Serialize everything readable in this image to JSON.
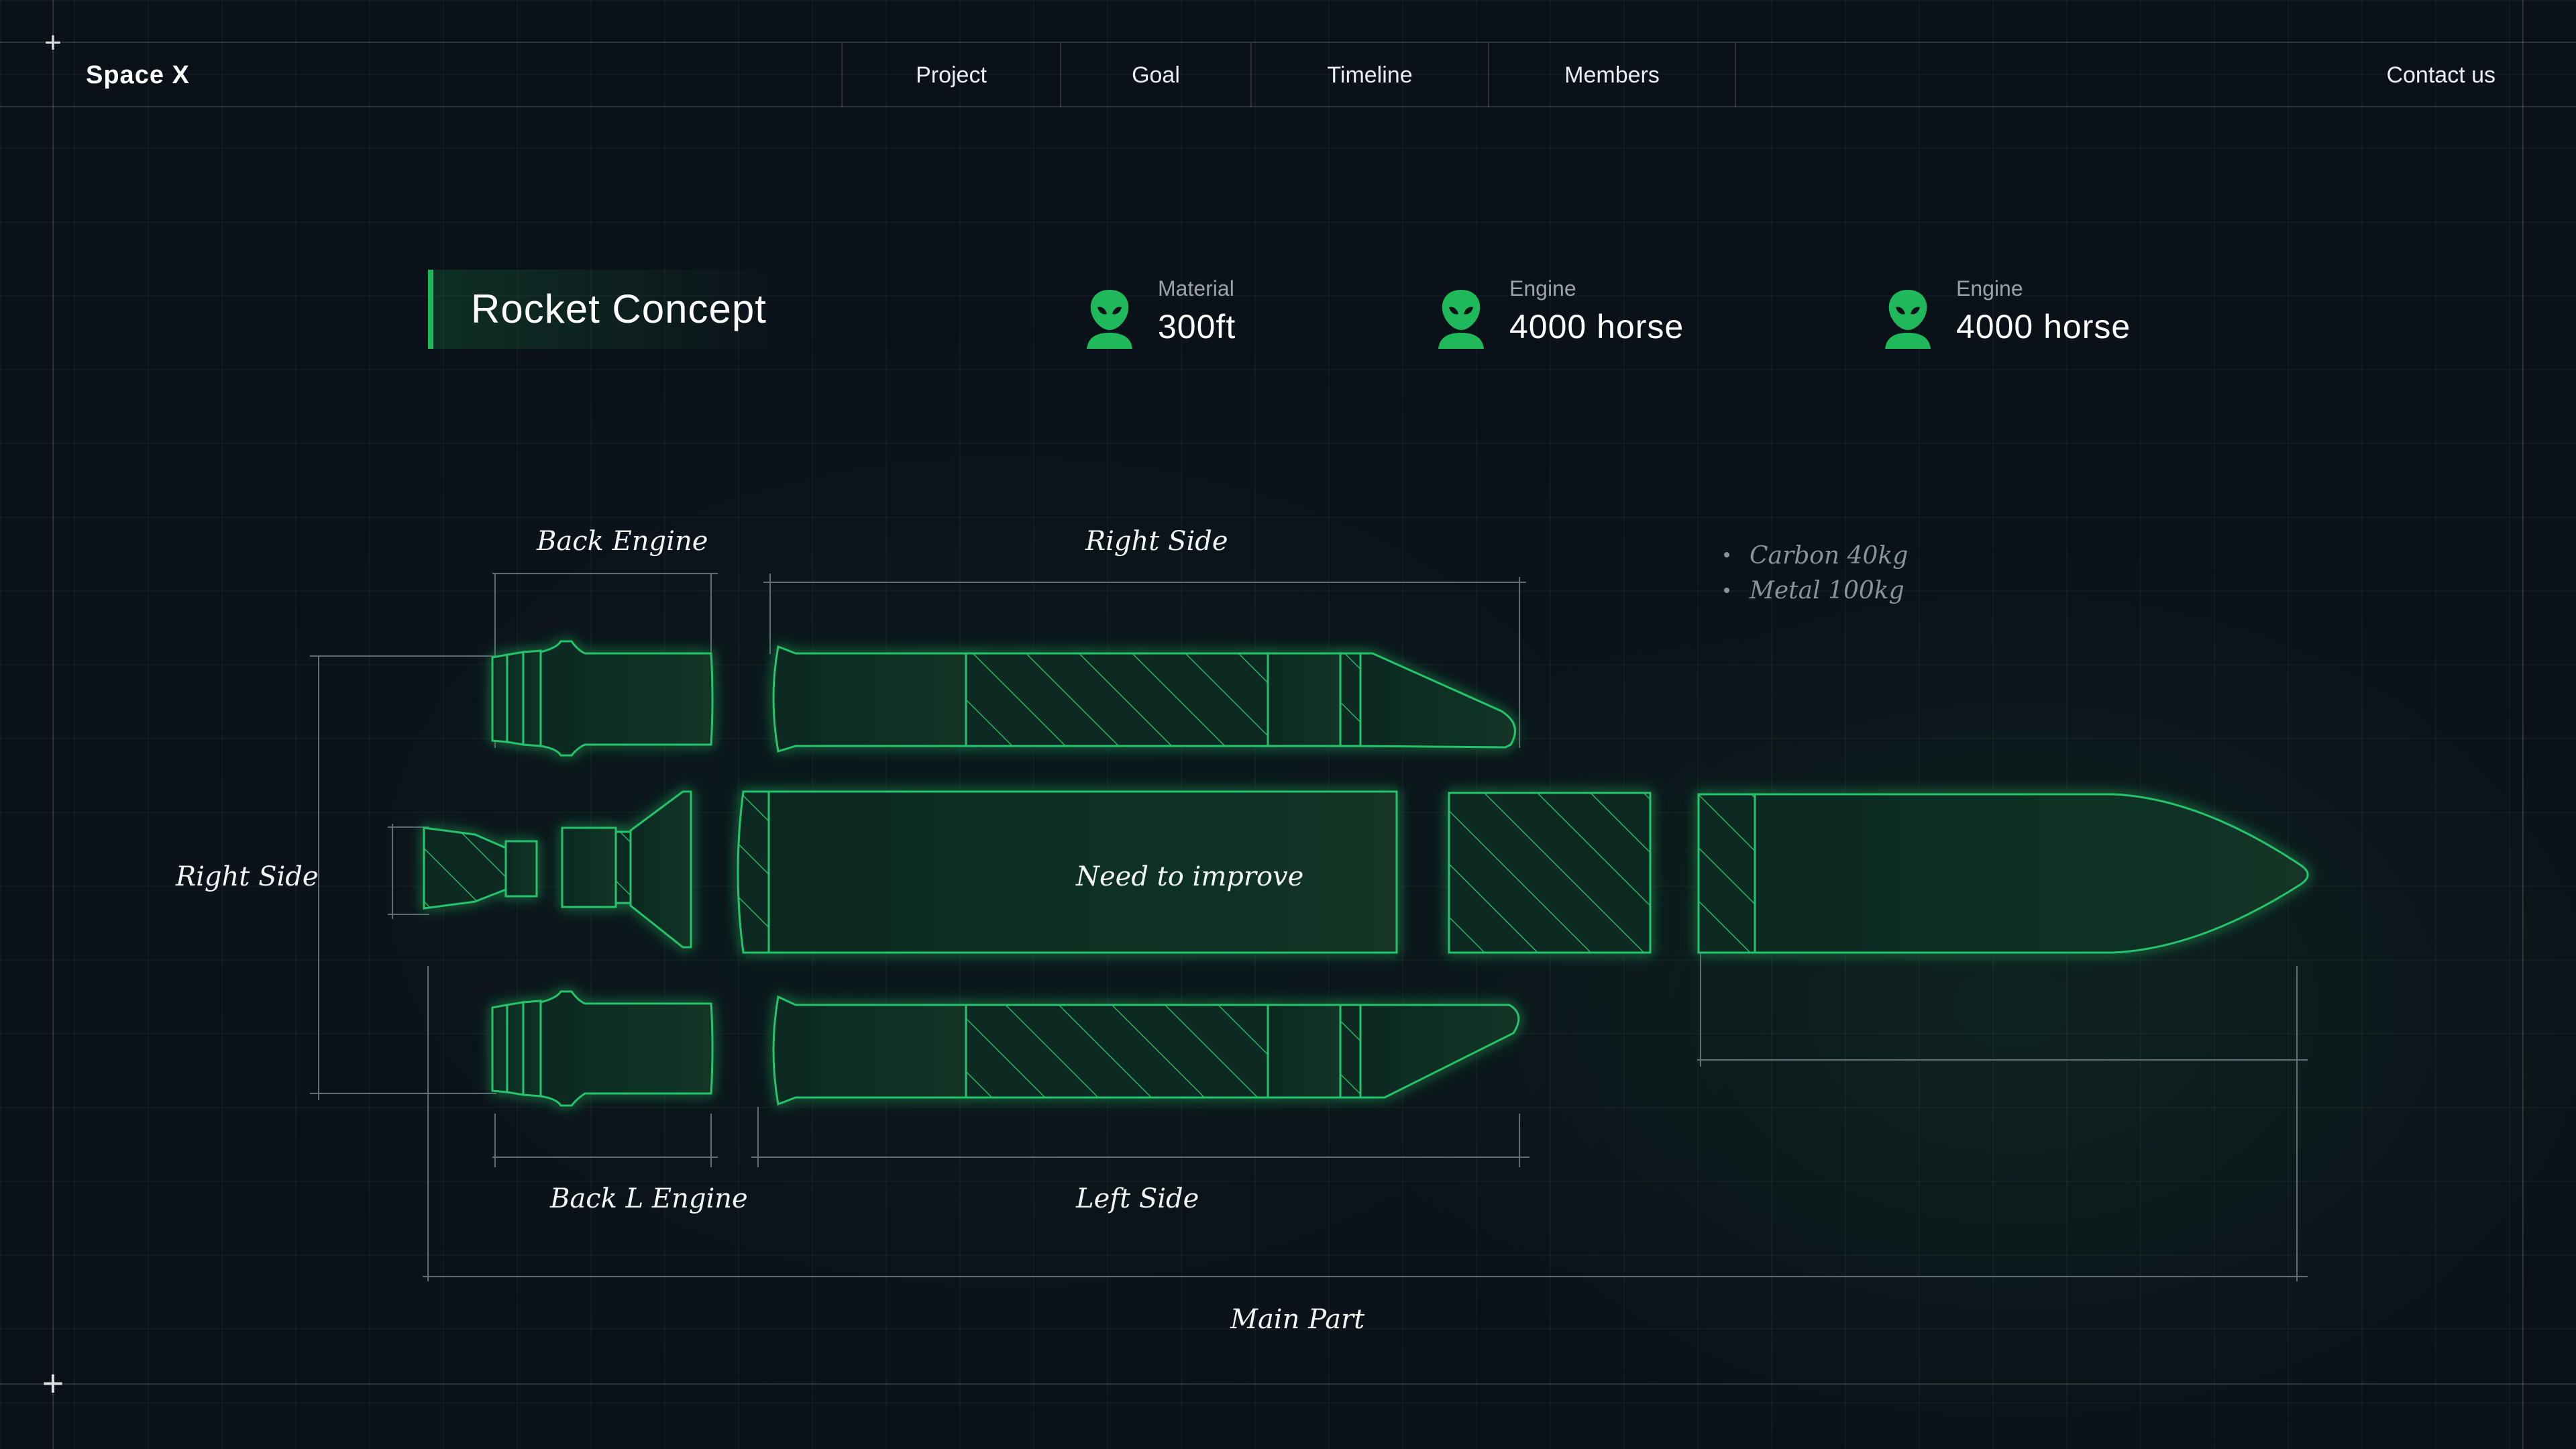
{
  "nav": {
    "brand": "Space X",
    "items": [
      {
        "label": "Project"
      },
      {
        "label": "Goal"
      },
      {
        "label": "Timeline"
      },
      {
        "label": "Members"
      }
    ],
    "contact": "Contact us"
  },
  "header": {
    "title": "Rocket Concept",
    "stats": [
      {
        "label": "Material",
        "value": "300ft",
        "icon": "alien-icon"
      },
      {
        "label": "Engine",
        "value": "4000 horse",
        "icon": "alien-icon"
      },
      {
        "label": "Engine",
        "value": "4000 horse",
        "icon": "alien-icon"
      }
    ]
  },
  "diagram": {
    "labels": {
      "back_engine": "Back Engine",
      "right_side_top": "Right Side",
      "right_side_left": "Right Side",
      "center_note": "Need to improve",
      "back_l_engine": "Back L Engine",
      "left_side": "Left Side",
      "main_part": "Main Part"
    },
    "notes": [
      "Carbon 40kg",
      "Metal 100kg"
    ]
  },
  "colors": {
    "accent": "#1fb85a",
    "outline": "#27c46a",
    "background": "#0b1119"
  }
}
